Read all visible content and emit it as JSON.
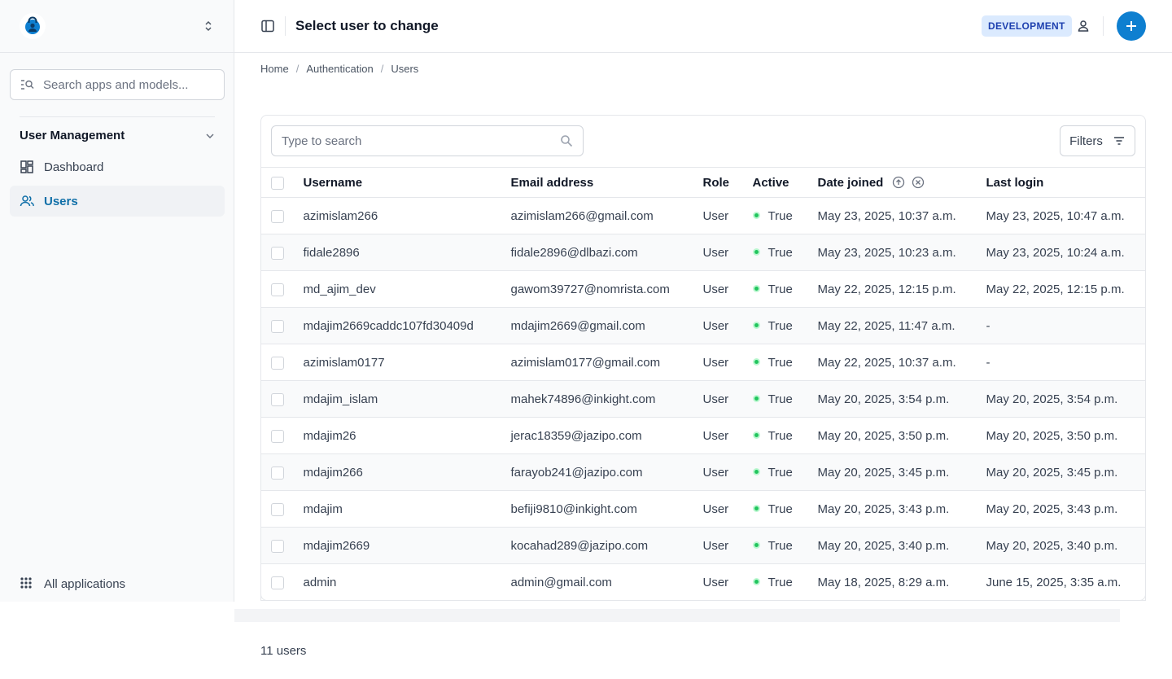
{
  "header": {
    "title": "Select user to change",
    "env_badge": "DEVELOPMENT"
  },
  "sidebar": {
    "search_placeholder": "Search apps and models...",
    "group_label": "User Management",
    "items": [
      {
        "label": "Dashboard",
        "icon": "dashboard-icon"
      },
      {
        "label": "Users",
        "icon": "users-icon",
        "active": true
      }
    ],
    "all_apps_label": "All applications"
  },
  "breadcrumb": [
    "Home",
    "Authentication",
    "Users"
  ],
  "toolbar": {
    "search_placeholder": "Type to search",
    "filters_label": "Filters"
  },
  "table": {
    "headers": [
      "Username",
      "Email address",
      "Role",
      "Active",
      "Date joined",
      "Last login"
    ],
    "rows": [
      {
        "username": "azimislam266",
        "email": "azimislam266@gmail.com",
        "role": "User",
        "active": "True",
        "joined": "May 23, 2025, 10:37 a.m.",
        "last_login": "May 23, 2025, 10:47 a.m."
      },
      {
        "username": "fidale2896",
        "email": "fidale2896@dlbazi.com",
        "role": "User",
        "active": "True",
        "joined": "May 23, 2025, 10:23 a.m.",
        "last_login": "May 23, 2025, 10:24 a.m."
      },
      {
        "username": "md_ajim_dev",
        "email": "gawom39727@nomrista.com",
        "role": "User",
        "active": "True",
        "joined": "May 22, 2025, 12:15 p.m.",
        "last_login": "May 22, 2025, 12:15 p.m."
      },
      {
        "username": "mdajim2669caddc107fd30409d",
        "email": "mdajim2669@gmail.com",
        "role": "User",
        "active": "True",
        "joined": "May 22, 2025, 11:47 a.m.",
        "last_login": "-"
      },
      {
        "username": "azimislam0177",
        "email": "azimislam0177@gmail.com",
        "role": "User",
        "active": "True",
        "joined": "May 22, 2025, 10:37 a.m.",
        "last_login": "-"
      },
      {
        "username": "mdajim_islam",
        "email": "mahek74896@inkight.com",
        "role": "User",
        "active": "True",
        "joined": "May 20, 2025, 3:54 p.m.",
        "last_login": "May 20, 2025, 3:54 p.m."
      },
      {
        "username": "mdajim26",
        "email": "jerac18359@jazipo.com",
        "role": "User",
        "active": "True",
        "joined": "May 20, 2025, 3:50 p.m.",
        "last_login": "May 20, 2025, 3:50 p.m."
      },
      {
        "username": "mdajim266",
        "email": "farayob241@jazipo.com",
        "role": "User",
        "active": "True",
        "joined": "May 20, 2025, 3:45 p.m.",
        "last_login": "May 20, 2025, 3:45 p.m."
      },
      {
        "username": "mdajim",
        "email": "befiji9810@inkight.com",
        "role": "User",
        "active": "True",
        "joined": "May 20, 2025, 3:43 p.m.",
        "last_login": "May 20, 2025, 3:43 p.m."
      },
      {
        "username": "mdajim2669",
        "email": "kocahad289@jazipo.com",
        "role": "User",
        "active": "True",
        "joined": "May 20, 2025, 3:40 p.m.",
        "last_login": "May 20, 2025, 3:40 p.m."
      },
      {
        "username": "admin",
        "email": "admin@gmail.com",
        "role": "User",
        "active": "True",
        "joined": "May 18, 2025, 8:29 a.m.",
        "last_login": "June 15, 2025, 3:35 a.m."
      }
    ]
  },
  "footer": {
    "count_text": "11 users"
  },
  "colors": {
    "accent": "#0e7fd0",
    "active_nav": "#0f6fa8",
    "badge_bg": "#dbeafe",
    "badge_text": "#1e40af",
    "status_true": "#22c55e"
  }
}
